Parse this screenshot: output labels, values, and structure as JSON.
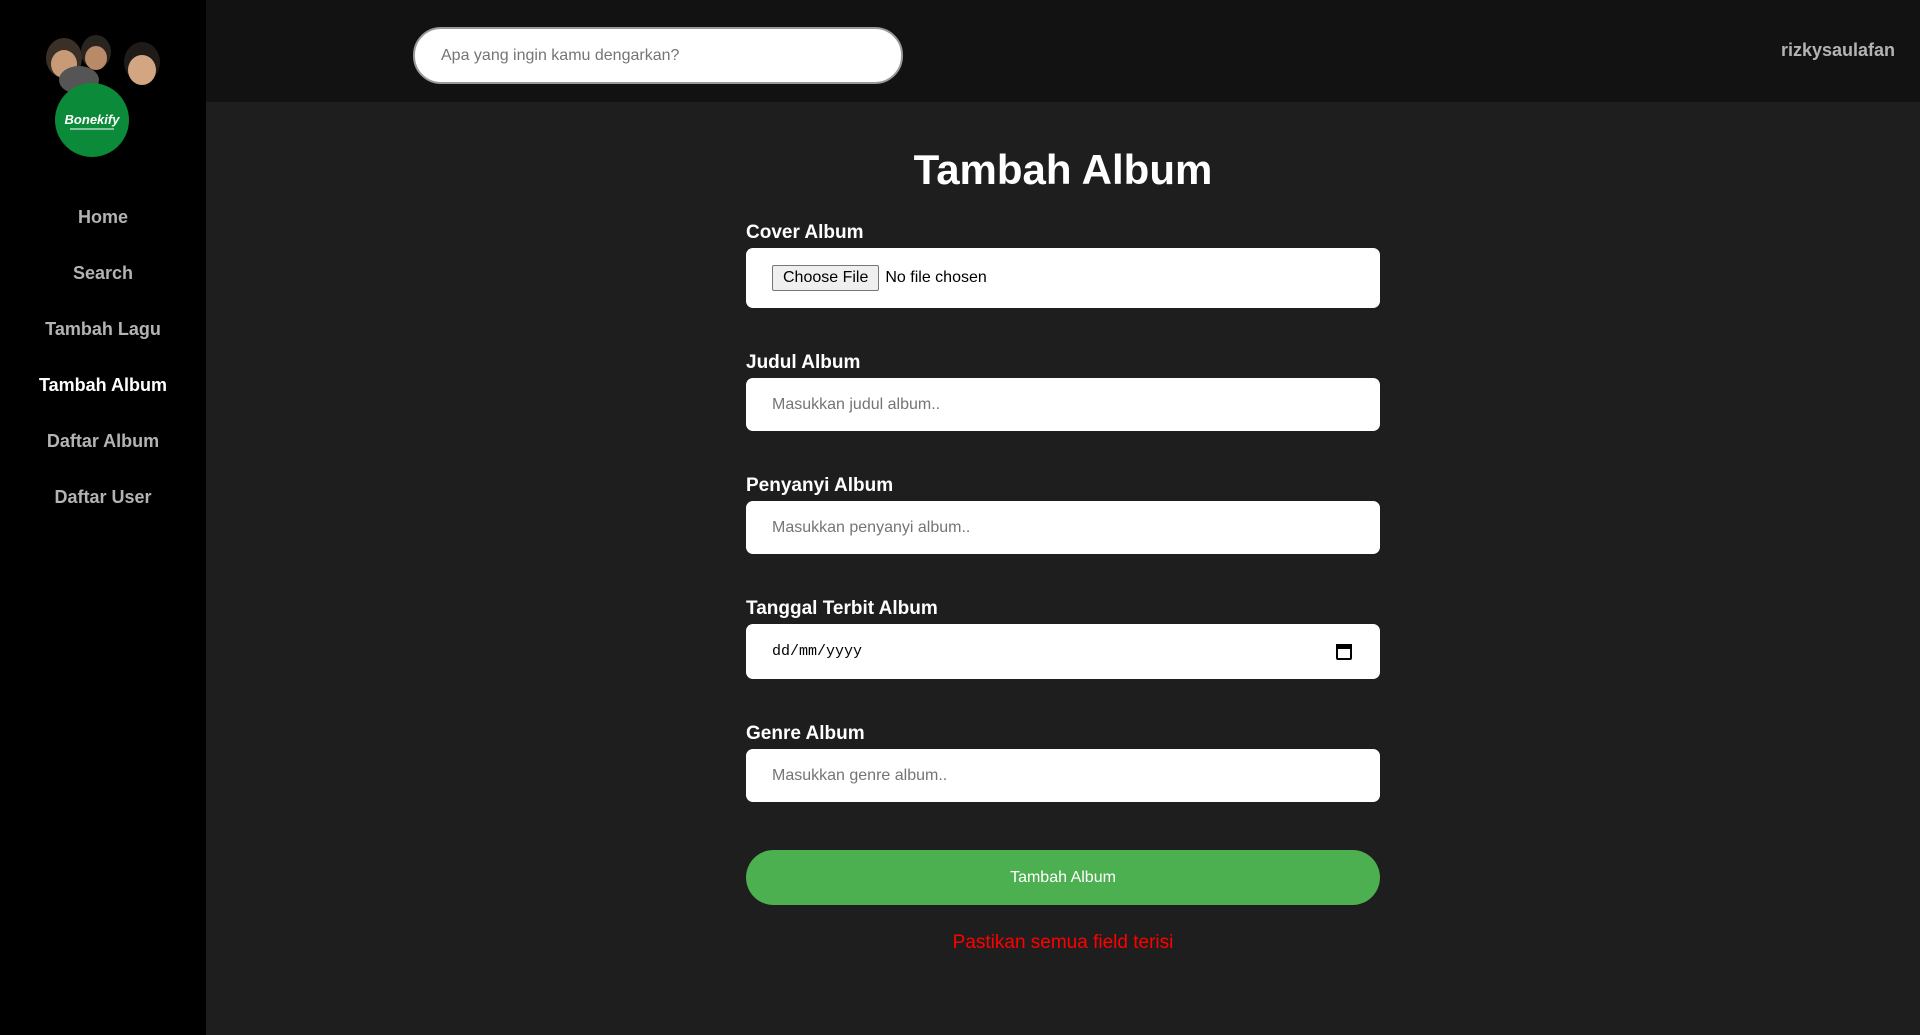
{
  "sidebar": {
    "logo_text": "Bonekify",
    "items": [
      {
        "label": "Home"
      },
      {
        "label": "Search"
      },
      {
        "label": "Tambah Lagu"
      },
      {
        "label": "Tambah Album"
      },
      {
        "label": "Daftar Album"
      },
      {
        "label": "Daftar User"
      }
    ],
    "active_item": "Tambah Album"
  },
  "header": {
    "search_placeholder": "Apa yang ingin kamu dengarkan?",
    "username": "rizkysaulafan"
  },
  "main": {
    "title": "Tambah Album",
    "fields": {
      "cover": {
        "label": "Cover Album",
        "button": "Choose File",
        "status": "No file chosen"
      },
      "judul": {
        "label": "Judul Album",
        "placeholder": "Masukkan judul album.."
      },
      "penyanyi": {
        "label": "Penyanyi Album",
        "placeholder": "Masukkan penyanyi album.."
      },
      "tanggal": {
        "label": "Tanggal Terbit Album",
        "placeholder": "dd/mm/yyyy"
      },
      "genre": {
        "label": "Genre Album",
        "placeholder": "Masukkan genre album.."
      }
    },
    "submit_label": "Tambah Album",
    "error_message": "Pastikan semua field terisi"
  },
  "colors": {
    "accent_green": "#4caf50",
    "logo_green": "#0b8a3a",
    "error_red": "#ff0000",
    "sidebar_bg": "#000000",
    "main_bg": "#1e1e1e",
    "topbar_bg": "#121212"
  }
}
